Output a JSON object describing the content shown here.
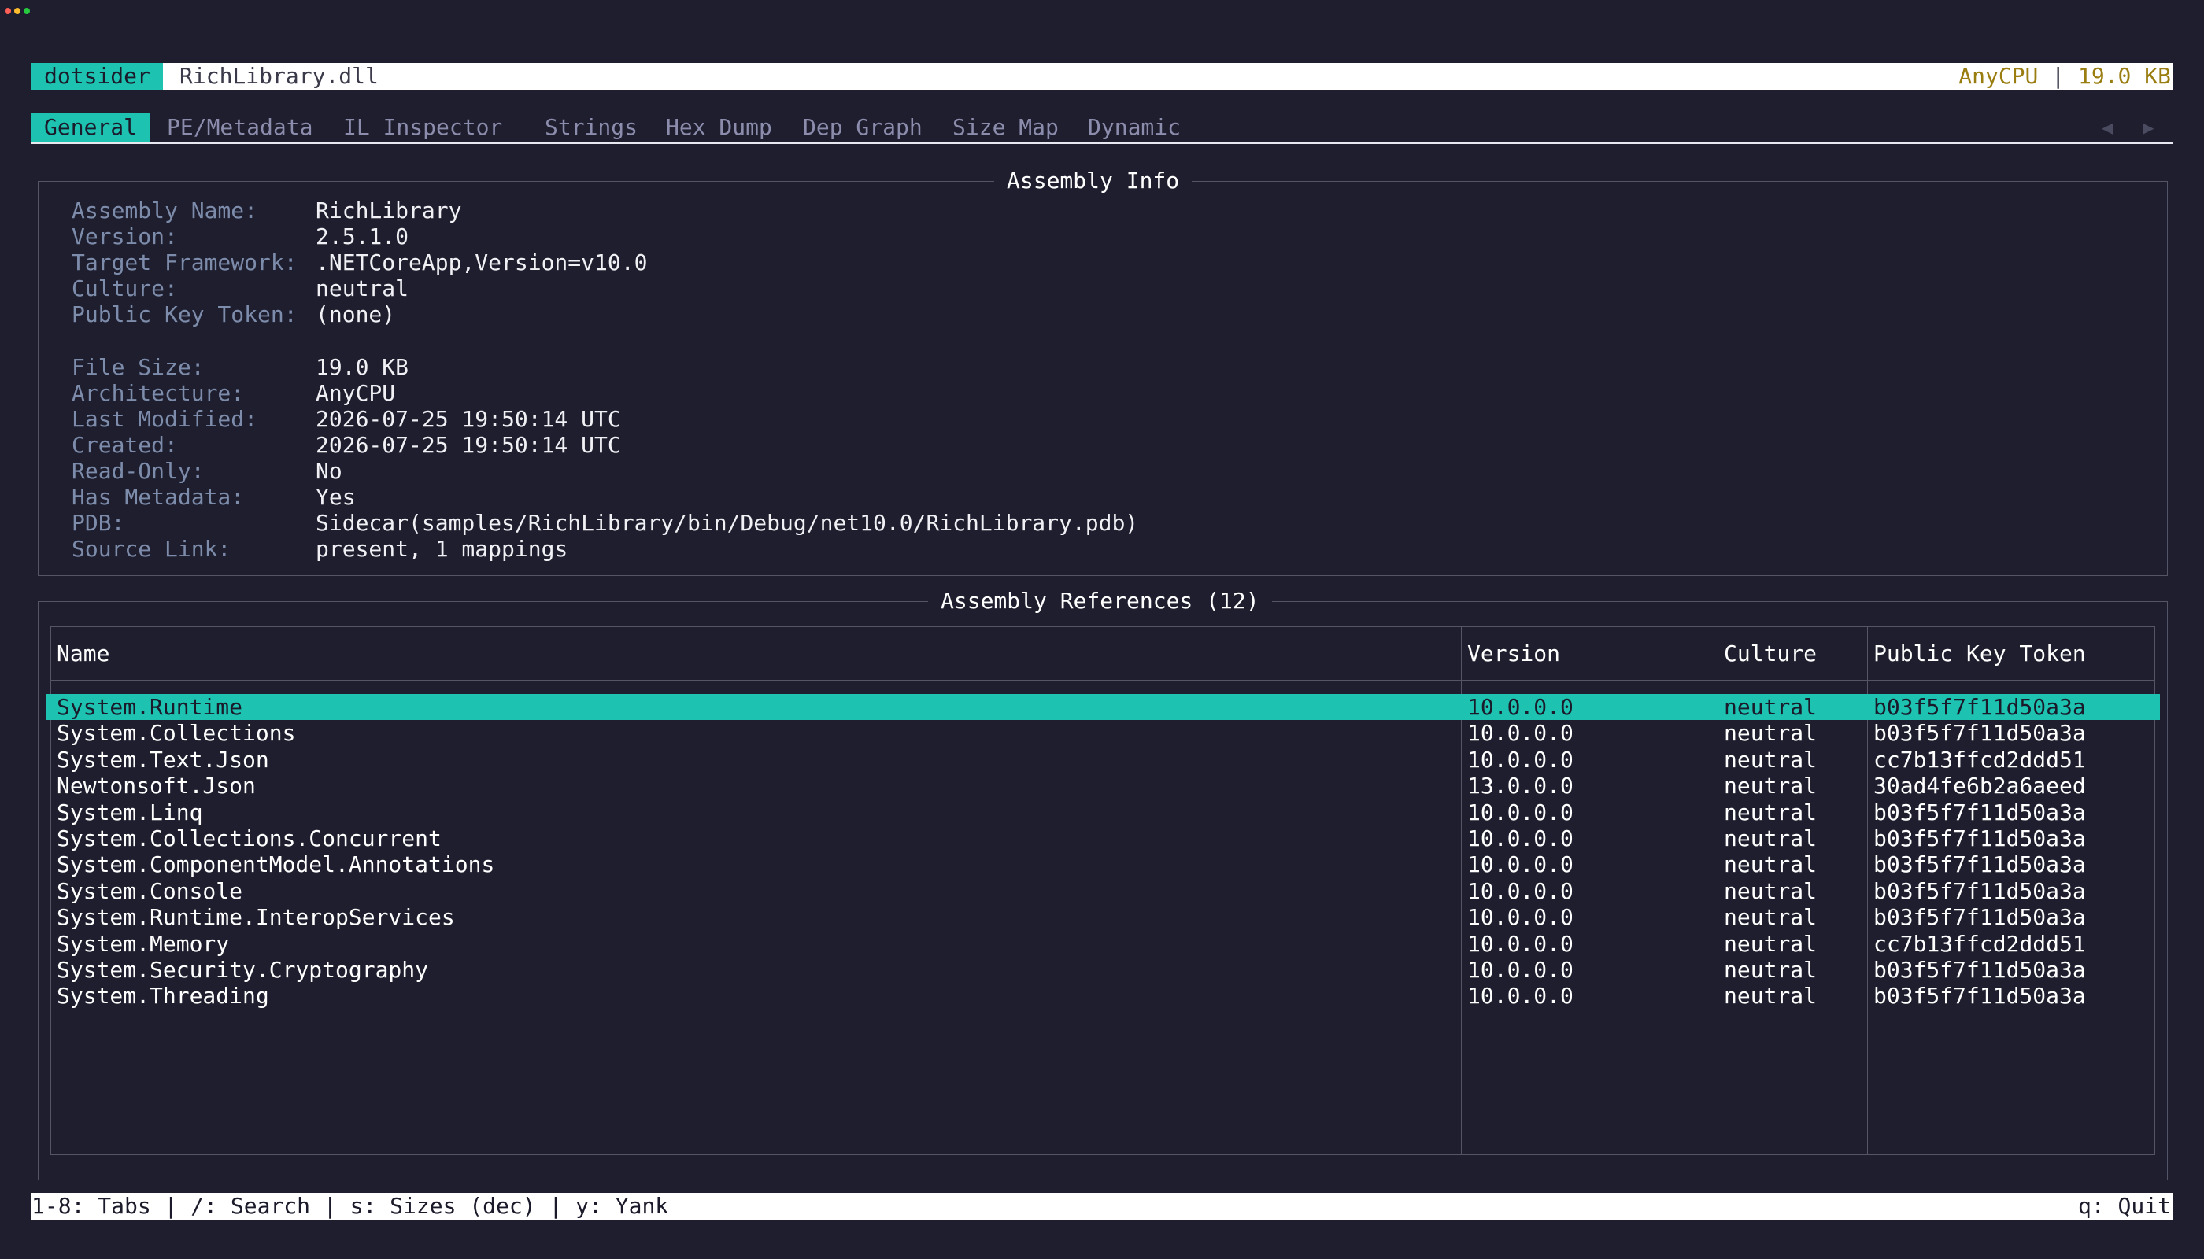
{
  "window": {
    "dot_colors": [
      "#ff5f56",
      "#ffbd2e",
      "#27c93f"
    ]
  },
  "header": {
    "app_name": "dotsider",
    "file_name": "RichLibrary.dll",
    "architecture": "AnyCPU",
    "separator": "|",
    "file_size": "19.0 KB"
  },
  "tabs": {
    "items": [
      {
        "label": "General",
        "active": true
      },
      {
        "label": "PE/Metadata"
      },
      {
        "label": "IL Inspector"
      },
      {
        "label": "Strings"
      },
      {
        "label": "Hex Dump"
      },
      {
        "label": "Dep Graph"
      },
      {
        "label": "Size Map"
      },
      {
        "label": "Dynamic"
      }
    ],
    "prev_arrow": "◀",
    "next_arrow": "▶"
  },
  "assembly_info": {
    "title": "Assembly Info",
    "rows": [
      {
        "label": "Assembly Name:",
        "value": "RichLibrary"
      },
      {
        "label": "Version:",
        "value": "2.5.1.0"
      },
      {
        "label": "Target Framework:",
        "value": ".NETCoreApp,Version=v10.0"
      },
      {
        "label": "Culture:",
        "value": "neutral"
      },
      {
        "label": "Public Key Token:",
        "value": "(none)"
      },
      {
        "label": "File Size:",
        "value": "19.0 KB"
      },
      {
        "label": "Architecture:",
        "value": "AnyCPU"
      },
      {
        "label": "Last Modified:",
        "value": "2026-07-25 19:50:14 UTC"
      },
      {
        "label": "Created:",
        "value": "2026-07-25 19:50:14 UTC"
      },
      {
        "label": "Read-Only:",
        "value": "No"
      },
      {
        "label": "Has Metadata:",
        "value": "Yes"
      },
      {
        "label": "PDB:",
        "value": "Sidecar(samples/RichLibrary/bin/Debug/net10.0/RichLibrary.pdb)"
      },
      {
        "label": "Source Link:",
        "value": "present, 1 mappings"
      }
    ]
  },
  "references": {
    "title": "Assembly References (12)",
    "columns": {
      "name": "Name",
      "version": "Version",
      "culture": "Culture",
      "token": "Public Key Token"
    },
    "rows": [
      {
        "name": "System.Runtime",
        "version": "10.0.0.0",
        "culture": "neutral",
        "token": "b03f5f7f11d50a3a",
        "selected": true
      },
      {
        "name": "System.Collections",
        "version": "10.0.0.0",
        "culture": "neutral",
        "token": "b03f5f7f11d50a3a"
      },
      {
        "name": "System.Text.Json",
        "version": "10.0.0.0",
        "culture": "neutral",
        "token": "cc7b13ffcd2ddd51"
      },
      {
        "name": "Newtonsoft.Json",
        "version": "13.0.0.0",
        "culture": "neutral",
        "token": "30ad4fe6b2a6aeed"
      },
      {
        "name": "System.Linq",
        "version": "10.0.0.0",
        "culture": "neutral",
        "token": "b03f5f7f11d50a3a"
      },
      {
        "name": "System.Collections.Concurrent",
        "version": "10.0.0.0",
        "culture": "neutral",
        "token": "b03f5f7f11d50a3a"
      },
      {
        "name": "System.ComponentModel.Annotations",
        "version": "10.0.0.0",
        "culture": "neutral",
        "token": "b03f5f7f11d50a3a"
      },
      {
        "name": "System.Console",
        "version": "10.0.0.0",
        "culture": "neutral",
        "token": "b03f5f7f11d50a3a"
      },
      {
        "name": "System.Runtime.InteropServices",
        "version": "10.0.0.0",
        "culture": "neutral",
        "token": "b03f5f7f11d50a3a"
      },
      {
        "name": "System.Memory",
        "version": "10.0.0.0",
        "culture": "neutral",
        "token": "cc7b13ffcd2ddd51"
      },
      {
        "name": "System.Security.Cryptography",
        "version": "10.0.0.0",
        "culture": "neutral",
        "token": "b03f5f7f11d50a3a"
      },
      {
        "name": "System.Threading",
        "version": "10.0.0.0",
        "culture": "neutral",
        "token": "b03f5f7f11d50a3a"
      }
    ]
  },
  "footer": {
    "hints": "1-8: Tabs | /: Search | s: Sizes (dec) | y: Yank",
    "quit": "q: Quit"
  }
}
